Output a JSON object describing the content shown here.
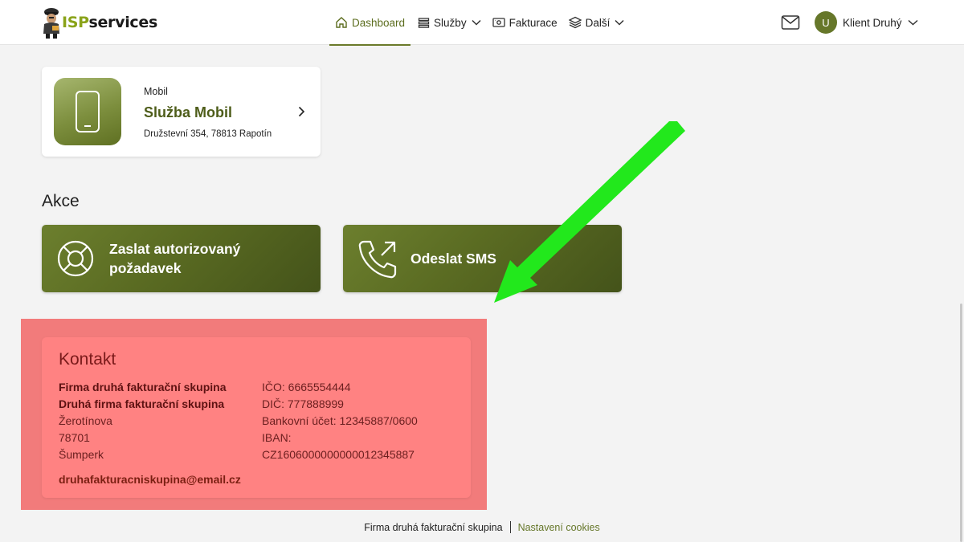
{
  "header": {
    "logo": {
      "part1": "ISP",
      "part2": "services"
    },
    "nav": [
      {
        "label": "Dashboard",
        "icon": "home-icon",
        "active": true
      },
      {
        "label": "Služby",
        "icon": "list-icon",
        "dropdown": true
      },
      {
        "label": "Fakturace",
        "icon": "banknote-icon"
      },
      {
        "label": "Další",
        "icon": "layers-icon",
        "dropdown": true
      }
    ],
    "user": {
      "initial": "U",
      "name": "Klient Druhý"
    }
  },
  "service": {
    "type": "Mobil",
    "name": "Služba Mobil",
    "address": "Družstevní 354, 78813 Rapotín"
  },
  "actions": {
    "title": "Akce",
    "items": [
      {
        "label": "Zaslat autorizovaný požadavek",
        "icon": "lifebuoy-icon"
      },
      {
        "label": "Odeslat SMS",
        "icon": "phone-outgoing-icon"
      }
    ]
  },
  "contact": {
    "title": "Kontakt",
    "company1": "Firma druhá fakturační skupina",
    "company2": "Druhá firma fakturační skupina",
    "street": "Žerotínova",
    "zip": "78701",
    "city": "Šumperk",
    "ico": "IČO: 6665554444",
    "dic": "DIČ: 777888999",
    "bank": "Bankovní účet: 12345887/0600",
    "iban_label": "IBAN:",
    "iban": "CZ1606000000000012345887",
    "email": "druhafakturacniskupina@email.cz"
  },
  "footer": {
    "company": "Firma druhá fakturační skupina",
    "cookies": "Nastavení cookies"
  },
  "colors": {
    "accent": "#66772a",
    "highlight": "#f27b7b",
    "annotation_arrow": "#22e81c"
  }
}
